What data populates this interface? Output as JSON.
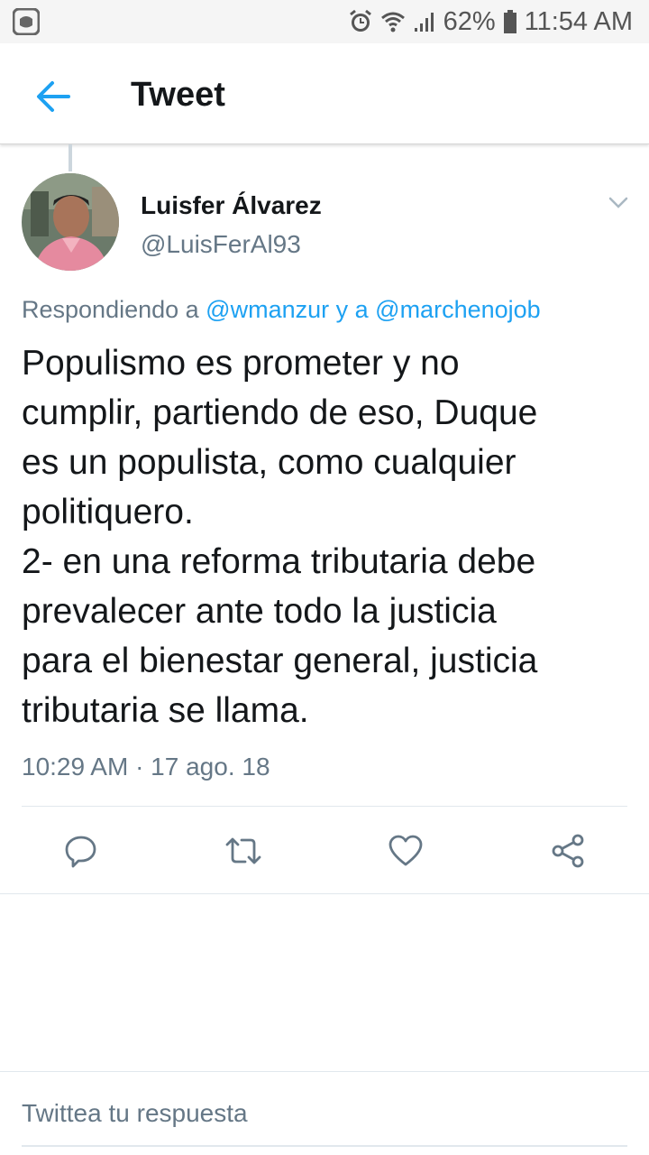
{
  "status_bar": {
    "battery": "62%",
    "time": "11:54 AM",
    "icons": [
      "app-icon",
      "alarm-icon",
      "wifi-icon",
      "signal-icon",
      "battery-icon"
    ]
  },
  "header": {
    "title": "Tweet",
    "back_icon": "arrow-left-icon"
  },
  "tweet": {
    "author_name": "Luisfer Álvarez",
    "author_handle": "@LuisFerAl93",
    "replying_prefix": "Respondiendo a ",
    "replying_mention_1": "@wmanzur",
    "replying_joiner": " y a ",
    "replying_mention_2": "@marchenojob",
    "text": "Populismo es prometer y no\ncumplir, partiendo de eso, Duque\nes un populista, como cualquier\npolitiquero.\n2- en una reforma tributaria debe\nprevalecer ante todo la justicia\npara el bienestar general, justicia\ntributaria se llama.",
    "timestamp": "10:29 AM · 17 ago. 18"
  },
  "actions": [
    "reply-icon",
    "retweet-icon",
    "like-icon",
    "share-icon"
  ],
  "reply_box": {
    "placeholder": "Twittea tu respuesta"
  },
  "colors": {
    "accent": "#1da1f2",
    "secondary_text": "#657786",
    "primary_text": "#14171a"
  }
}
